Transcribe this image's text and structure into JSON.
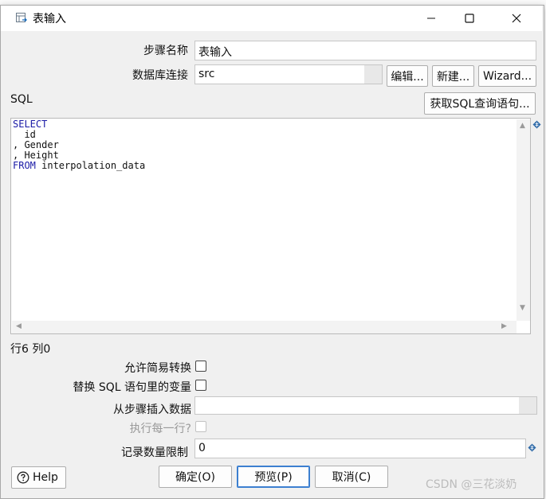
{
  "dialog": {
    "title": "表输入",
    "minimize_icon": "minimize-icon",
    "maximize_icon": "maximize-icon",
    "close_icon": "close-icon"
  },
  "form": {
    "step_name_label": "步骤名称",
    "step_name_value": "表输入",
    "db_connection_label": "数据库连接",
    "db_connection_value": "src",
    "edit_button": "编辑...",
    "new_button": "新建...",
    "wizard_button": "Wizard...",
    "sql_label": "SQL",
    "get_sql_button": "获取SQL查询语句..."
  },
  "sql": {
    "lines": [
      {
        "keyword": "SELECT",
        "text": ""
      },
      {
        "keyword": "",
        "text": "  id"
      },
      {
        "keyword": "",
        "text": ", Gender"
      },
      {
        "keyword": "",
        "text": ", Height"
      },
      {
        "keyword": "FROM",
        "text": " interpolation_data"
      }
    ],
    "cursor_status": "行6 列0"
  },
  "options": {
    "lazy_conversion_label": "允许简易转换",
    "replace_vars_label": "替换 SQL 语句里的变量",
    "insert_from_step_label": "从步骤插入数据",
    "insert_from_step_value": "",
    "execute_each_row_label": "执行每一行?",
    "limit_label": "记录数量限制",
    "limit_value": "0"
  },
  "footer": {
    "help_button": "Help",
    "ok_button": "确定(O)",
    "preview_button": "预览(P)",
    "cancel_button": "取消(C)"
  },
  "watermark": "CSDN @三花淡奶"
}
